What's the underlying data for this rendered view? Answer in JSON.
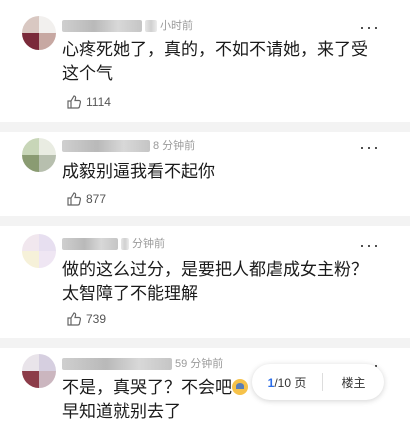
{
  "comments": [
    {
      "time": "小时前",
      "text": "心疼死她了，真的，不如不请她，来了受这个气",
      "likes": "1114"
    },
    {
      "time": "8 分钟前",
      "text": "成毅别逼我看不起你",
      "likes": "877"
    },
    {
      "time": "分钟前",
      "text": "做的这么过分，是要把人都虐成女主粉？太智障了不能理解",
      "likes": "739"
    },
    {
      "time": "59 分钟前",
      "text": "不是，真哭了？不会吧",
      "text2": "早知道就别去了",
      "likes": ""
    }
  ],
  "more_label": "···",
  "pager": {
    "current": "1",
    "total": "/10 页",
    "floor_owner": "楼主"
  },
  "icons": {
    "like": "thumbs-up-icon",
    "more": "more-dots-icon",
    "emoji": "anxious-face-emoji"
  },
  "colors": {
    "accent": "#2b6de8",
    "divider": "#f3f3f3"
  }
}
